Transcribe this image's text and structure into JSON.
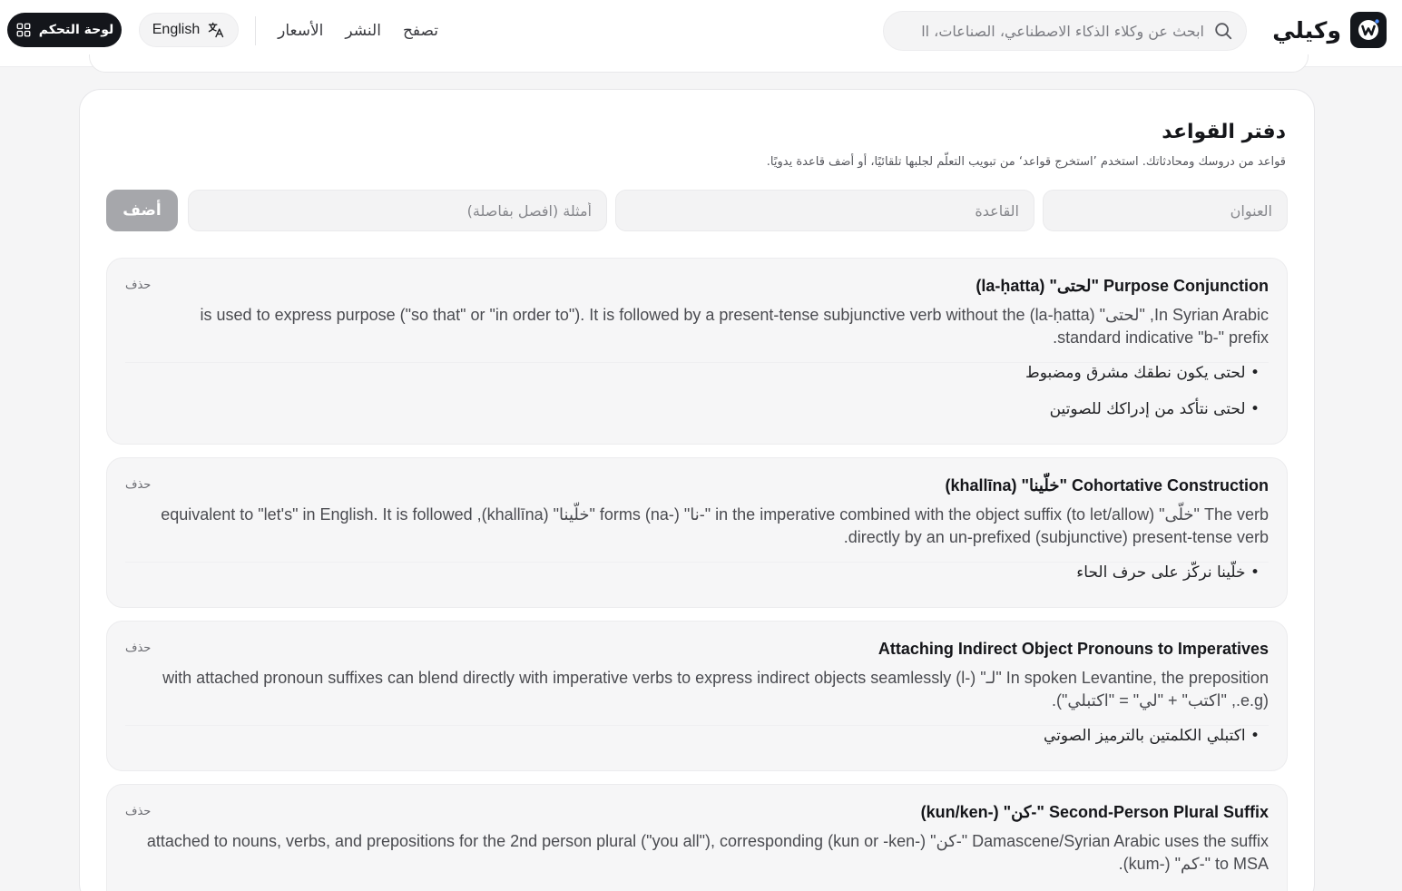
{
  "header": {
    "brand_name": "وكيلي",
    "search_placeholder": "ابحث عن وكلاء الذكاء الاصطناعي، الصناعات، اا",
    "nav": [
      "تصفح",
      "النشر",
      "الأسعار"
    ],
    "language_label": "English",
    "dashboard_label": "لوحة التحكم"
  },
  "page": {
    "title": "دفتر القواعد",
    "subtitle": "قواعد من دروسك ومحادثاتك. استخدم ’استخرج قواعد‘ من تبويب التعلّم لجلبها تلقائيًا، أو أضف قاعدة يدويًا.",
    "form": {
      "title_placeholder": "العنوان",
      "rule_placeholder": "القاعدة",
      "examples_placeholder": "أمثلة (افصل بفاصلة)",
      "add_label": "أضف"
    }
  },
  "rules": [
    {
      "title": "Purpose Conjunction \"لحتى\" (la-ḥatta)",
      "description": "In Syrian Arabic, \"لحتى\" (la-ḥatta) is used to express purpose (\"so that\" or \"in order to\"). It is followed by a present-tense subjunctive verb without the standard indicative \"b-\" prefix.",
      "examples": [
        "• لحتى يكون نطقك مشرق ومضبوط",
        "• لحتى نتأكد من إدراكك للصوتين"
      ],
      "delete_label": "حذف"
    },
    {
      "title": "Cohortative Construction \"خلّينا\" (khallīna)",
      "description": "The verb \"خلّى\" (to let/allow) in the imperative combined with the object suffix \"-نا\" (-na) forms \"خلّينا\" (khallīna), equivalent to \"let's\" in English. It is followed directly by an un-prefixed (subjunctive) present-tense verb.",
      "examples": [
        "• خلّينا نركّز على حرف الحاء"
      ],
      "delete_label": "حذف"
    },
    {
      "title": "Attaching Indirect Object Pronouns to Imperatives",
      "description": "In spoken Levantine, the preposition \"لـ\" (-l) with attached pronoun suffixes can blend directly with imperative verbs to express indirect objects seamlessly (e.g., \"اكتب\" + \"لي\" = \"اكتبلي\").",
      "examples": [
        "• اكتبلي الكلمتين بالترميز الصوتي"
      ],
      "delete_label": "حذف"
    },
    {
      "title": "Second-Person Plural Suffix \"-كن\" (-kun/ken)",
      "description": "Damascene/Syrian Arabic uses the suffix \"-كن\" (-kun or -ken) attached to nouns, verbs, and prepositions for the 2nd person plural (\"you all\"), corresponding to MSA \"-كم\" (-kum).",
      "examples": [],
      "delete_label": "حذف"
    }
  ]
}
